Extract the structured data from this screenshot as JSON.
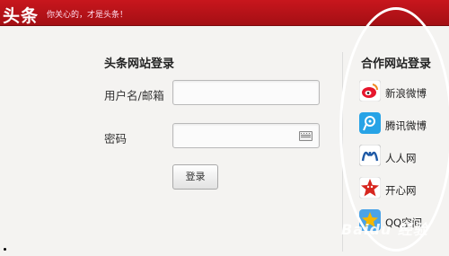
{
  "header": {
    "logo": "头条",
    "slogan": "你关心的，才是头条！"
  },
  "login": {
    "title": "头条网站登录",
    "username_label": "用户名/邮箱",
    "password_label": "密码",
    "username_value": "",
    "password_value": "",
    "submit_label": "登录"
  },
  "partners": {
    "title": "合作网站登录",
    "items": [
      {
        "label": "新浪微博",
        "icon": "sina-weibo-icon",
        "color": "#e6162d"
      },
      {
        "label": "腾讯微博",
        "icon": "tencent-weibo-icon",
        "color": "#27a3e6"
      },
      {
        "label": "人人网",
        "icon": "renren-icon",
        "color": "#1f5aa6"
      },
      {
        "label": "开心网",
        "icon": "kaixin-icon",
        "color": "#d7261f"
      },
      {
        "label": "QQ空间",
        "icon": "qzone-icon",
        "color": "#f5b700"
      }
    ]
  },
  "watermark": "Baidu 经验",
  "colors": {
    "header": "#c8161d",
    "background": "#f4f3f1"
  }
}
